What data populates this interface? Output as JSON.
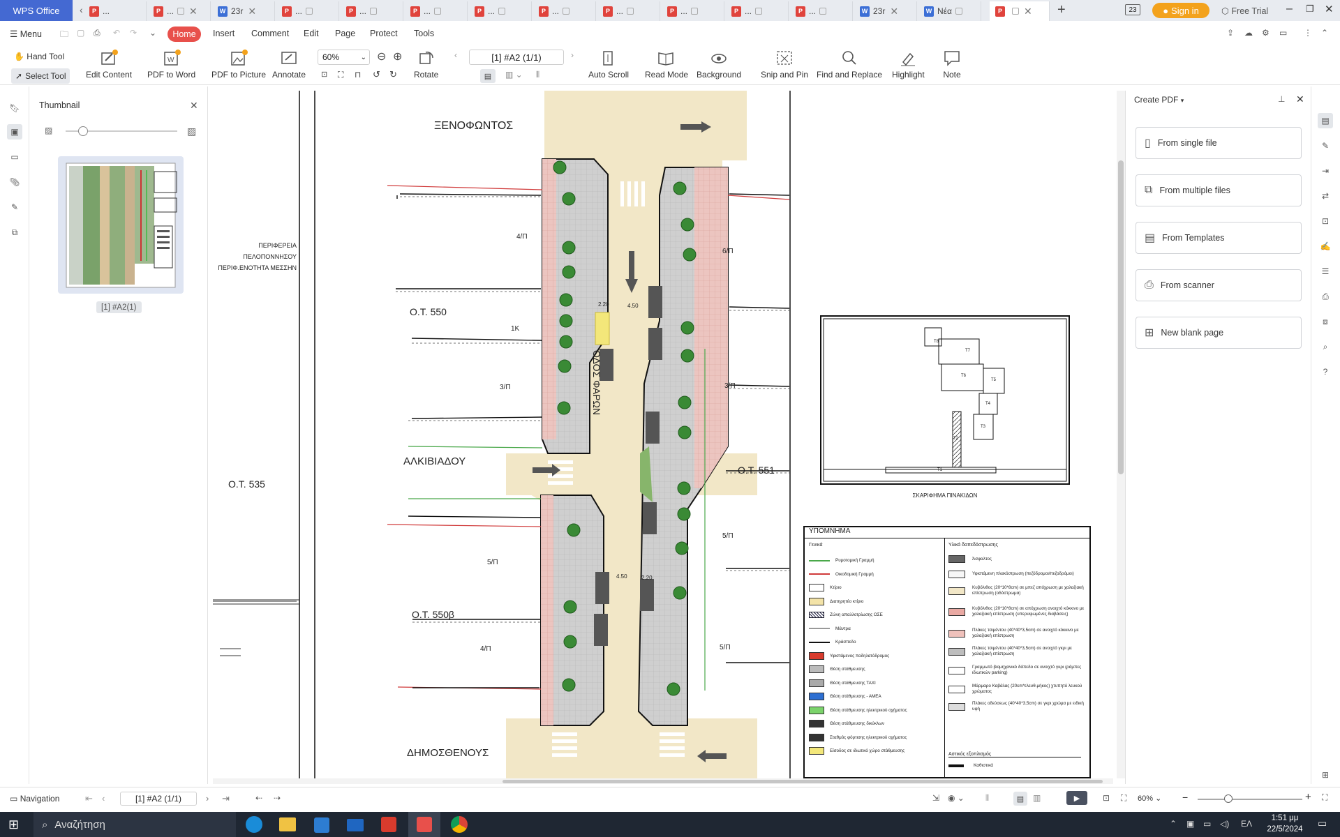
{
  "app": {
    "name": "WPS Office"
  },
  "tabs": [
    {
      "label": "...",
      "type": "pdf"
    },
    {
      "label": "...",
      "type": "pdf"
    },
    {
      "label": "23r",
      "type": "doc"
    },
    {
      "label": "...",
      "type": "pdf"
    },
    {
      "label": "...",
      "type": "pdf"
    },
    {
      "label": "...",
      "type": "pdf"
    },
    {
      "label": "...",
      "type": "pdf"
    },
    {
      "label": "...",
      "type": "pdf"
    },
    {
      "label": "...",
      "type": "pdf"
    },
    {
      "label": "...",
      "type": "pdf"
    },
    {
      "label": "...",
      "type": "pdf"
    },
    {
      "label": "...",
      "type": "pdf"
    },
    {
      "label": "23r",
      "type": "doc"
    },
    {
      "label": "Νέα",
      "type": "doc"
    },
    {
      "label": "",
      "type": "pdf",
      "active": true
    }
  ],
  "titlebar": {
    "sign_in": "Sign in",
    "free_trial": "Free Trial",
    "counter": "23"
  },
  "menu": {
    "menu_label": "Menu",
    "items": [
      "Home",
      "Insert",
      "Comment",
      "Edit",
      "Page",
      "Protect",
      "Tools"
    ]
  },
  "toolbar": {
    "hand_tool": "Hand Tool",
    "select_tool": "Select Tool",
    "edit_content": "Edit Content",
    "pdf_to_word": "PDF to Word",
    "pdf_to_picture": "PDF to Picture",
    "annotate": "Annotate",
    "zoom": "60%",
    "rotate": "Rotate",
    "page_indicator": "[1] #A2 (1/1)",
    "auto_scroll": "Auto Scroll",
    "read_mode": "Read Mode",
    "background": "Background",
    "snip_and_pin": "Snip and Pin",
    "find_replace": "Find and Replace",
    "highlight": "Highlight",
    "note": "Note"
  },
  "thumbnail_panel": {
    "title": "Thumbnail",
    "page_label": "[1] #A2(1)"
  },
  "drawing": {
    "region_lines": [
      "ΠΕΡΙΦΕΡΕΙΑ",
      "ΠΕΛΟΠΟΝΝΗΣΟΥ",
      "ΠΕΡΙΦ.ΕΝΟΤΗΤΑ ΜΕΣΣΗΝ"
    ],
    "streets": {
      "xenofontos": "ΞΕΝΟΦΩΝΤΟΣ",
      "alkiviadou": "ΑΛΚΙΒΙΑΔΟΥ",
      "dimosthenous": "ΔΗΜΟΣΘΕΝΟΥΣ",
      "odos_faron": "ΟΔΟΣ ΦΑΡΩΝ"
    },
    "blocks": {
      "ot550": "Ο.Τ. 550",
      "ot535": "Ο.Τ. 535",
      "ot551": "Ο.Τ. 551",
      "ot550b": "Ο.Τ. 550β"
    },
    "floors": {
      "f4p_a": "4/Π",
      "f6p": "6/Π",
      "f1k": "1Κ",
      "f3p_a": "3/Π",
      "f3p_b": "3/Π",
      "f5p_a": "5/Π",
      "f5p_b": "5/Π",
      "f4p_b": "4/Π",
      "f5p_c": "5/Π"
    },
    "dims": {
      "d220a": "2.20",
      "d450a": "4.50",
      "d450b": "4.50",
      "d220b": "2.20"
    },
    "sketch": {
      "caption": "ΣΚΑΡΙΦΗΜΑ ΠΙΝΑΚΙΔΩΝ",
      "labels": [
        "Τ8",
        "Τ7",
        "Τ6",
        "Τ5",
        "Τ4",
        "Τ3",
        "Τ2",
        "Τ1"
      ]
    },
    "legend": {
      "title": "ΥΠΟΜΝΗΜΑ",
      "general_title": "Γενικά",
      "materials_title": "Υλικά δαπεδόστρωσης",
      "general_items": [
        "Ρυμοτομική Γραμμή",
        "Οικοδομική Γραμμή",
        "Κτίριο",
        "Διατηρητέο κτίριο",
        "Ζώνη απαλλοτρίωσης ΟΣΕ",
        "Μάντρα",
        "Κράσπεδο",
        "Υφιστάμενος ποδηλατόδρομος",
        "Θέση στάθμευσης",
        "Θέση στάθμευσης ΤΑΧΙ",
        "Θέση στάθμευσης - ΑΜΕΑ",
        "Θέση στάθμευσης ηλεκτρικού οχήματος",
        "Θέση στάθμευσης δικύκλων",
        "Σταθμός φόρτισης ηλεκτρικού οχήματος",
        "Είσοδος σε ιδιωτικό χώρο στάθμευσης"
      ],
      "material_items": [
        "Άσφαλτος",
        "Υφιστάμενη πλακόστρωση (πεζόδρομοι/πεζοδρόμοι)",
        "Κυβόλιθος (20*10*8cm) σε μπεζ απόχρωση με χαλαζιακή επίστρωση (οδόστρωμα)",
        "Κυβόλιθος (20*10*8cm) σε απόχρωση ανοιχτό κόκκινο με χαλαζιακή επίστρωση (υπερυψωμένες διαβάσεις)",
        "Πλάκες τσιμέντου (40*40*3,5cm) σε ανοιχτό κόκκινο με χαλαζιακή επίστρωση",
        "Πλάκες τσιμέντου (40*40*3,5cm) σε ανοιχτό γκρι με χαλαζιακή επίστρωση",
        "Γραμμωτό βιομηχανικό δάπεδο σε ανοιχτό γκρι (ράμπες ιδιωτικών parking)",
        "Μάρμαρο Καβάλας (20cm*ελευθ.μήκος) χτυπητό λευκού χρώματος",
        "Πλάκες οδεύσεως (40*40*3,5cm) σε γκρι χρώμα με ειδική υφή"
      ],
      "urban_title": "Αστικός εξοπλισμός",
      "urban_items": [
        "Καθιστικά"
      ]
    }
  },
  "right_panel": {
    "title": "Create PDF",
    "buttons": [
      "From single file",
      "From multiple files",
      "From Templates",
      "From scanner",
      "New blank page"
    ]
  },
  "status": {
    "navigation": "Navigation",
    "page": "[1] #A2 (1/1)",
    "zoom": "60%"
  },
  "taskbar": {
    "search_placeholder": "Αναζήτηση",
    "lang": "ΕΛ",
    "time": "1:51 μμ",
    "date": "22/5/2024"
  },
  "colors": {
    "accent": "#e8504b",
    "wps_blue": "#4469d2",
    "sign_in": "#f3a21c"
  }
}
